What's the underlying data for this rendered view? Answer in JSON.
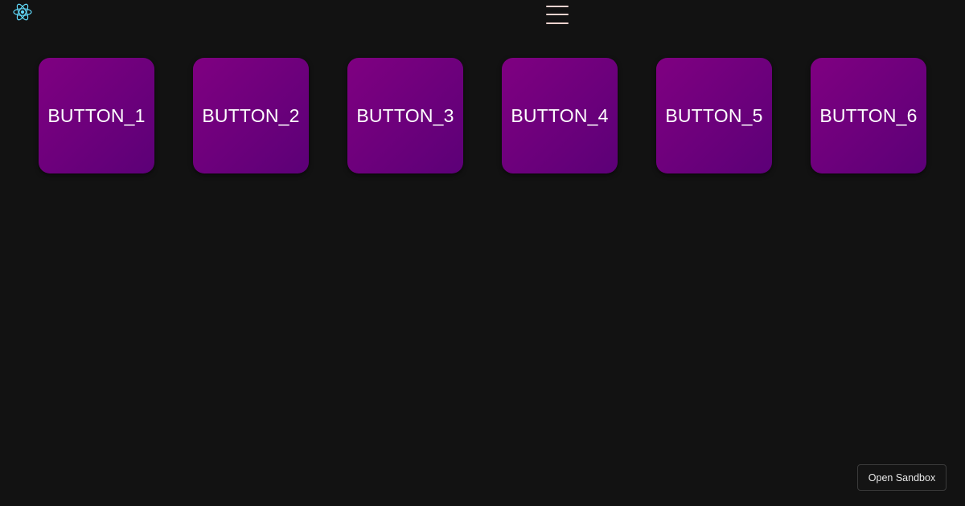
{
  "header": {
    "logo_icon": "react-atom-icon",
    "logo_color": "#61dafb",
    "menu_icon": "hamburger-menu-icon",
    "menu_color": "#f2d3cf"
  },
  "tiles": [
    {
      "label": "BUTTON_1"
    },
    {
      "label": "BUTTON_2"
    },
    {
      "label": "BUTTON_3"
    },
    {
      "label": "BUTTON_4"
    },
    {
      "label": "BUTTON_5"
    },
    {
      "label": "BUTTON_6"
    }
  ],
  "tile_colors": {
    "start": "#7f0081",
    "end": "#5c0077"
  },
  "footer": {
    "open_sandbox_label": "Open Sandbox"
  }
}
